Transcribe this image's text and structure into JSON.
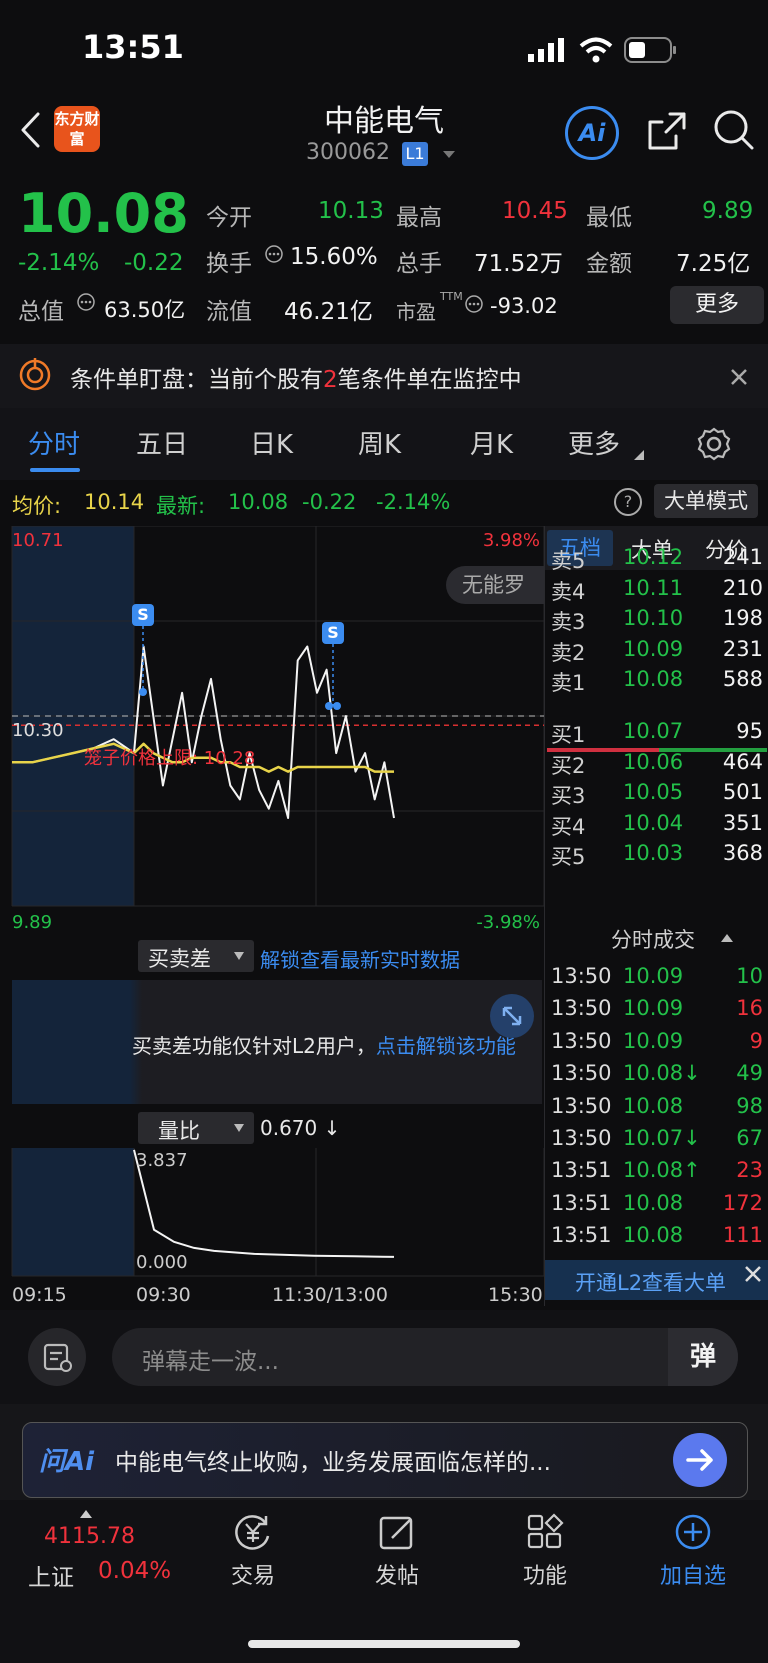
{
  "status": {
    "time": "13:51"
  },
  "header": {
    "brand_logo_text": "东方财富",
    "title": "中能电气",
    "code": "300062",
    "level_badge": "L1",
    "ai_label": "Ai"
  },
  "quote": {
    "price": "10.08",
    "change_pct": "-2.14%",
    "change": "-0.22",
    "open_label": "今开",
    "open": "10.13",
    "high_label": "最高",
    "high": "10.45",
    "low_label": "最低",
    "low": "9.89",
    "turnover_label": "换手",
    "turnover": "15.60%",
    "volume_label": "总手",
    "volume": "71.52万",
    "amount_label": "金额",
    "amount": "7.25亿",
    "mktcap_label": "总值",
    "mktcap": "63.50亿",
    "float_label": "流值",
    "float": "46.21亿",
    "pe_label": "市盈",
    "pe_tm": "TTM",
    "pe": "-93.02",
    "more_button": "更多"
  },
  "notice": {
    "prefix": "条件单盯盘：当前个股有",
    "count": "2",
    "suffix": "笔条件单在监控中"
  },
  "tabs": [
    "分时",
    "五日",
    "日K",
    "周K",
    "月K",
    "更多"
  ],
  "chart_header": {
    "avg_label": "均价:",
    "avg_value": "10.14",
    "latest_label": "最新:",
    "latest_value": "10.08",
    "latest_change": "-0.22",
    "latest_pct": "-2.14%",
    "help": "?",
    "big_order_mode": "大单模式"
  },
  "chart_data": {
    "type": "line",
    "y_max_label": "10.71",
    "y_min_label": "9.89",
    "pct_max_label": "3.98%",
    "pct_min_label": "-3.98%",
    "ref_line_label": "10.30",
    "cage_limit_label": "笼子价格上限: 10.28",
    "danmaku_hint": "无能罗",
    "x_labels": [
      "09:15",
      "09:30",
      "11:30/13:00",
      "15:30"
    ],
    "ylim": [
      9.89,
      10.71
    ],
    "series": [
      {
        "values": [
          10.2,
          10.2,
          10.21,
          10.22,
          10.23,
          10.25,
          10.22,
          10.45,
          10.3,
          10.15,
          10.25,
          10.35,
          10.2,
          10.3,
          10.38,
          10.25,
          10.15,
          10.12,
          10.22,
          10.14,
          10.1,
          10.16,
          10.08,
          10.42,
          10.45,
          10.35,
          10.4,
          10.22,
          10.3,
          10.18,
          10.22,
          10.12,
          10.2,
          10.08
        ]
      },
      {
        "values": [
          10.2,
          10.2,
          10.21,
          10.22,
          10.23,
          10.24,
          10.22,
          10.24,
          10.22,
          10.21,
          10.2,
          10.2,
          10.21,
          10.21,
          10.21,
          10.2,
          10.2,
          10.19,
          10.19,
          10.19,
          10.18,
          10.19,
          10.18,
          10.19,
          10.19,
          10.19,
          10.19,
          10.19,
          10.19,
          10.19,
          10.19,
          10.18,
          10.18,
          10.18
        ]
      }
    ]
  },
  "spread": {
    "label": "买卖差",
    "unlock_text": "解锁查看最新实时数据",
    "panel_text": "买卖差功能仅针对L2用户，",
    "panel_link": "点击解锁该功能"
  },
  "ratio": {
    "label": "量比",
    "value": "0.670 ↓",
    "max_label": "3.837",
    "min_label": "0.000",
    "values": [
      3.84,
      1.2,
      0.8,
      0.6,
      0.5,
      0.45,
      0.4,
      0.38,
      0.36,
      0.34,
      0.33,
      0.32,
      0.31,
      0.3
    ]
  },
  "depth": {
    "tabs": [
      "五档",
      "大单",
      "分价"
    ],
    "asks": [
      {
        "label": "卖5",
        "price": "10.12",
        "vol": "241"
      },
      {
        "label": "卖4",
        "price": "10.11",
        "vol": "210"
      },
      {
        "label": "卖3",
        "price": "10.10",
        "vol": "198"
      },
      {
        "label": "卖2",
        "price": "10.09",
        "vol": "231"
      },
      {
        "label": "卖1",
        "price": "10.08",
        "vol": "588"
      }
    ],
    "bids": [
      {
        "label": "买1",
        "price": "10.07",
        "vol": "95"
      },
      {
        "label": "买2",
        "price": "10.06",
        "vol": "464"
      },
      {
        "label": "买3",
        "price": "10.05",
        "vol": "501"
      },
      {
        "label": "买4",
        "price": "10.04",
        "vol": "351"
      },
      {
        "label": "买5",
        "price": "10.03",
        "vol": "368"
      }
    ]
  },
  "ticks": {
    "title": "分时成交",
    "rows": [
      {
        "t": "13:50",
        "p": "10.09",
        "v": "10",
        "vc": "#23c14a"
      },
      {
        "t": "13:50",
        "p": "10.09",
        "v": "16",
        "vc": "#f0323c"
      },
      {
        "t": "13:50",
        "p": "10.09",
        "v": "9",
        "vc": "#f0323c"
      },
      {
        "t": "13:50",
        "p": "10.08↓",
        "v": "49",
        "vc": "#23c14a"
      },
      {
        "t": "13:50",
        "p": "10.08",
        "v": "98",
        "vc": "#23c14a"
      },
      {
        "t": "13:50",
        "p": "10.07↓",
        "v": "67",
        "vc": "#23c14a"
      },
      {
        "t": "13:51",
        "p": "10.08↑",
        "v": "23",
        "vc": "#f0323c"
      },
      {
        "t": "13:51",
        "p": "10.08",
        "v": "172",
        "vc": "#f0323c"
      },
      {
        "t": "13:51",
        "p": "10.08",
        "v": "111",
        "vc": "#f0323c"
      }
    ],
    "l2_banner": "开通L2查看大单"
  },
  "danmaku": {
    "placeholder": "弹幕走一波...",
    "send": "弹"
  },
  "ai_bar": {
    "logo": "问Ai",
    "text": "中能电气终止收购，业务发展面临怎样的..."
  },
  "bottom_nav": {
    "index_value": "4115.78",
    "index_name": "上证",
    "index_pct": "0.04%",
    "items": [
      "交易",
      "发帖",
      "功能",
      "加自选"
    ]
  }
}
